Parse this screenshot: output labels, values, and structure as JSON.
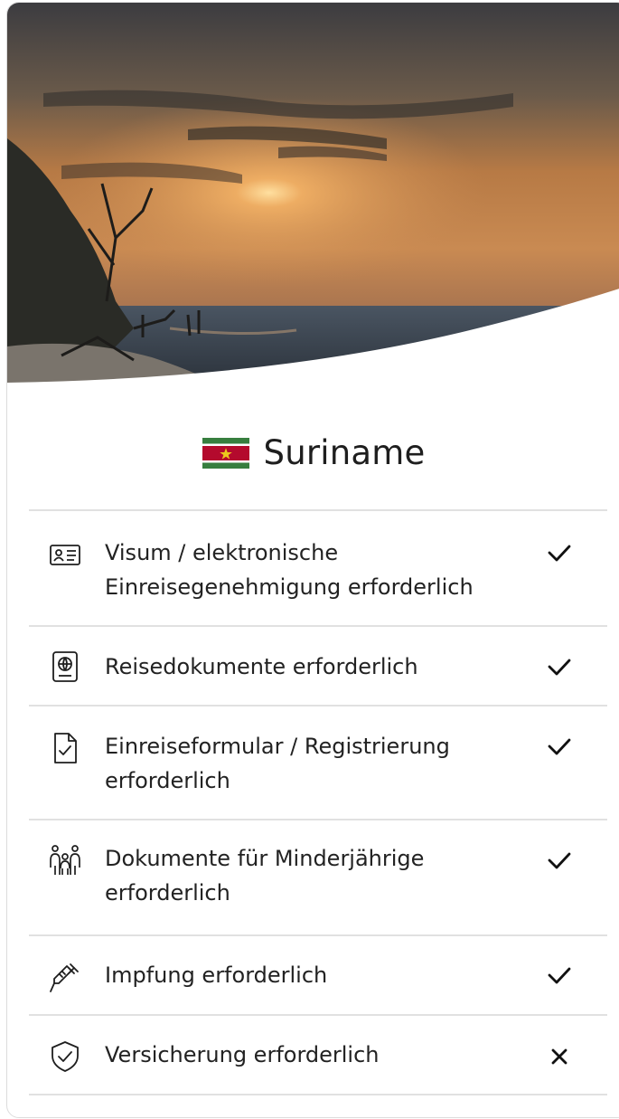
{
  "header": {
    "country": "Suriname",
    "flag_colors": {
      "green": "#377e3f",
      "white": "#ffffff",
      "red": "#b40a2d",
      "star": "#ecc81d"
    }
  },
  "requirements": [
    {
      "icon": "id-card-icon",
      "label": "Visum / elektronische Einreisegenehmigung erforderlich",
      "status": "check"
    },
    {
      "icon": "passport-icon",
      "label": "Reisedokumente erforderlich",
      "status": "check"
    },
    {
      "icon": "form-document-icon",
      "label": "Einreiseformular / Registrierung erforderlich",
      "status": "check"
    },
    {
      "icon": "family-icon",
      "label": "Dokumente für Minderjährige erforderlich",
      "status": "check"
    },
    {
      "icon": "syringe-icon",
      "label": "Impfung erforderlich",
      "status": "check"
    },
    {
      "icon": "shield-check-icon",
      "label": "Versicherung erforderlich",
      "status": "cross"
    }
  ]
}
